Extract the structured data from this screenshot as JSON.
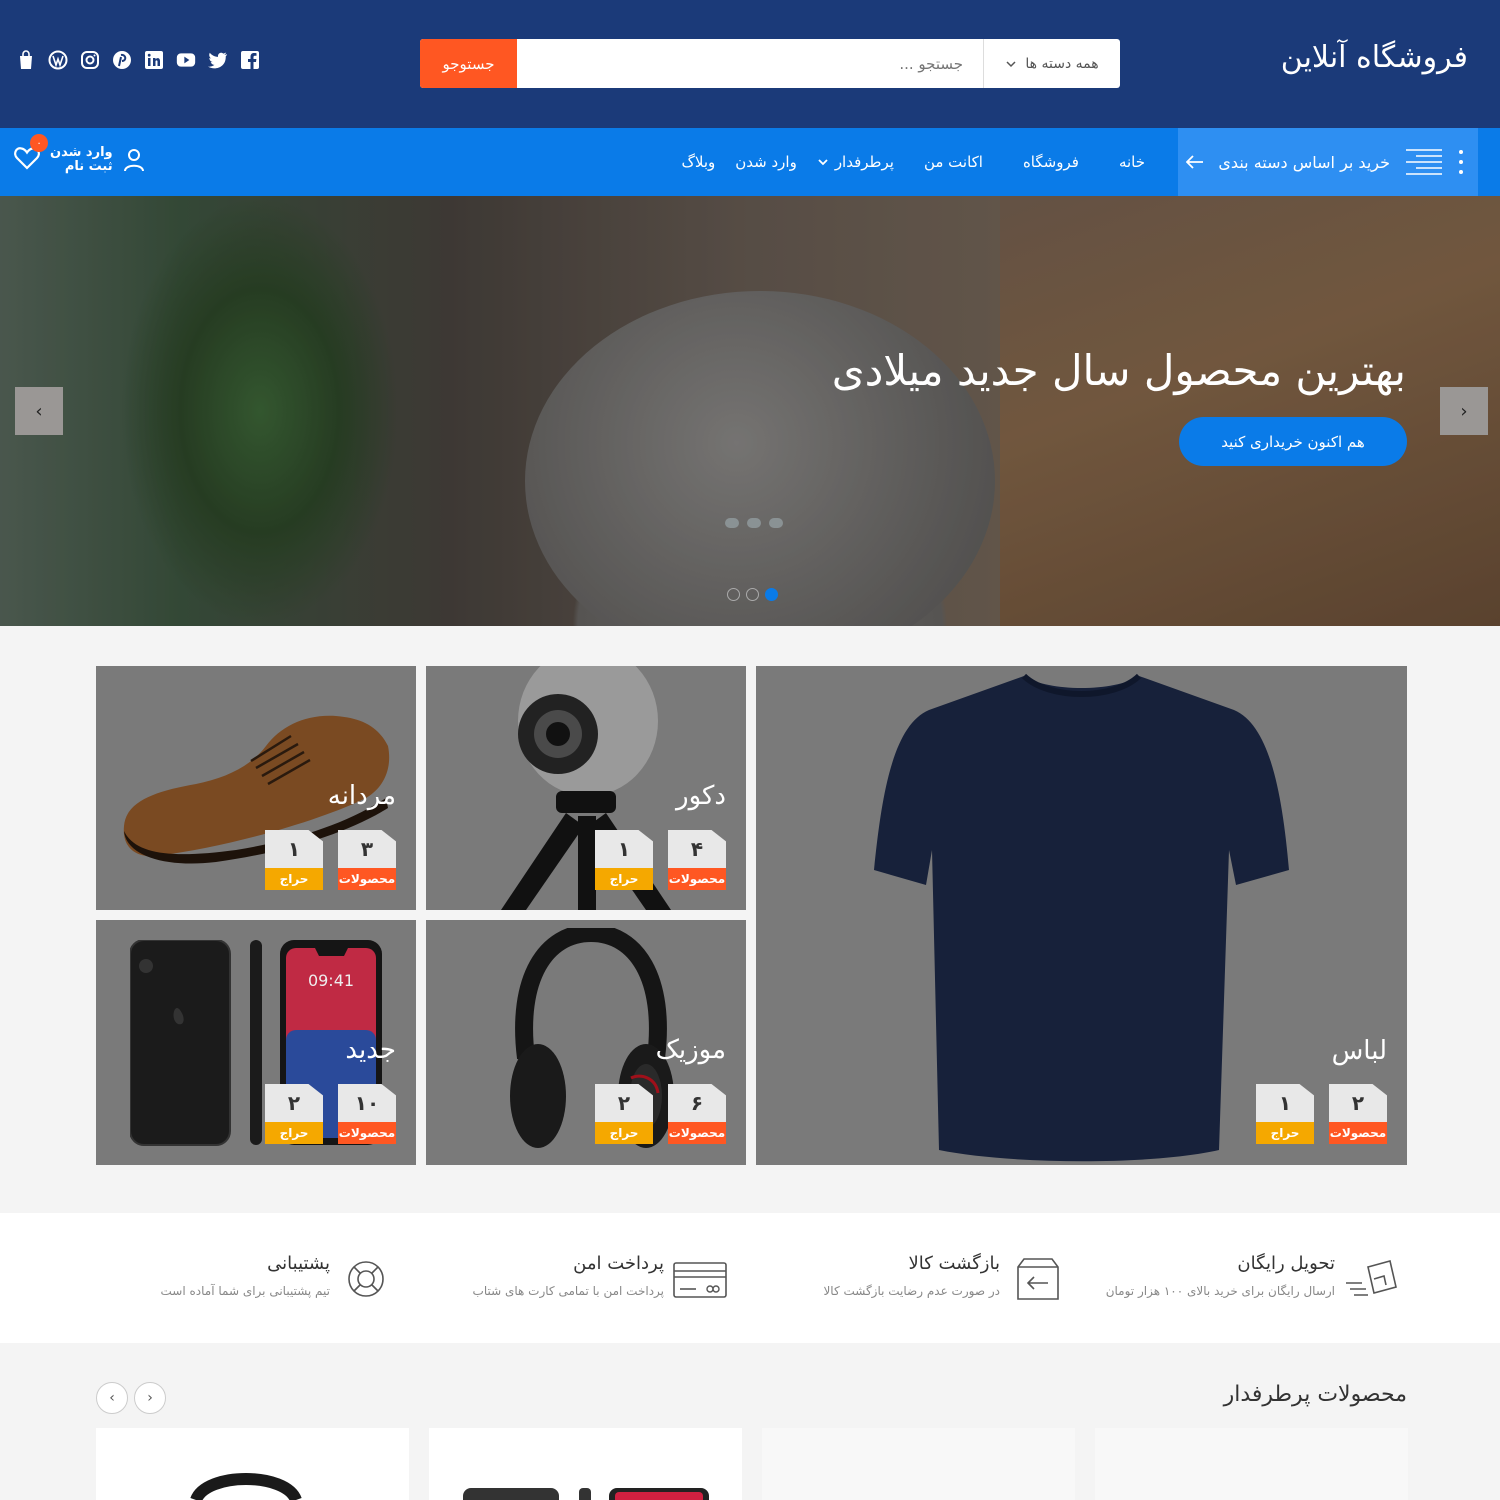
{
  "header": {
    "logo": "فروشگاه آنلاین",
    "search": {
      "button": "جستوجو",
      "placeholder": "جستجو ...",
      "category": "همه دسته ها"
    },
    "socials": [
      "facebook-icon",
      "twitter-icon",
      "youtube-icon",
      "linkedin-icon",
      "pinterest-icon",
      "instagram-icon",
      "wordpress-icon",
      "shopping-bag-icon"
    ]
  },
  "nav": {
    "category_button": "خرید بر اساس دسته بندی",
    "links": [
      "خانه",
      "فروشگاه",
      "اکانت من",
      "پرطرفدار",
      "وارد شدن",
      "وبلاگ"
    ],
    "account": {
      "login": "وارد شدن",
      "register": "ثبت نام"
    },
    "wishlist_count": "۰"
  },
  "hero": {
    "title": "بهترین محصول سال جدید میلادی",
    "cta": "هم اکنون خریداری کنید",
    "prev": "‹",
    "next": "›",
    "slide_count": 3,
    "active_slide": 3
  },
  "categories": [
    {
      "name": "لباس",
      "products": "۲",
      "sale": "۱",
      "products_label": "محصولات",
      "sale_label": "حراج"
    },
    {
      "name": "دکور",
      "products": "۴",
      "sale": "۱",
      "products_label": "محصولات",
      "sale_label": "حراج"
    },
    {
      "name": "مردانه",
      "products": "۳",
      "sale": "۱",
      "products_label": "محصولات",
      "sale_label": "حراج"
    },
    {
      "name": "موزیک",
      "products": "۶",
      "sale": "۲",
      "products_label": "محصولات",
      "sale_label": "حراج"
    },
    {
      "name": "جدید",
      "products": "۱۰",
      "sale": "۲",
      "products_label": "محصولات",
      "sale_label": "حراج"
    }
  ],
  "features": [
    {
      "title": "تحویل رایگان",
      "desc": "ارسال رایگان برای خرید بالای ۱۰۰ هزار تومان",
      "icon": "delivery-icon"
    },
    {
      "title": "بازگشت کالا",
      "desc": "در صورت عدم رضایت بازگشت کالا",
      "icon": "return-box-icon"
    },
    {
      "title": "پرداخت امن",
      "desc": "پرداخت امن با تمامی کارت های شتاب",
      "icon": "credit-card-icon"
    },
    {
      "title": "پشتیبانی",
      "desc": "تیم پشتیبانی برای شما آماده است",
      "icon": "lifebuoy-icon"
    }
  ],
  "popular": {
    "title": "محصولات پرطرفدار",
    "prev": "‹",
    "next": "›"
  },
  "colors": {
    "header_bg": "#1b3a79",
    "nav_bg": "#0a7be8",
    "accent_orange": "#ff5722",
    "accent_yellow": "#f5a800"
  }
}
